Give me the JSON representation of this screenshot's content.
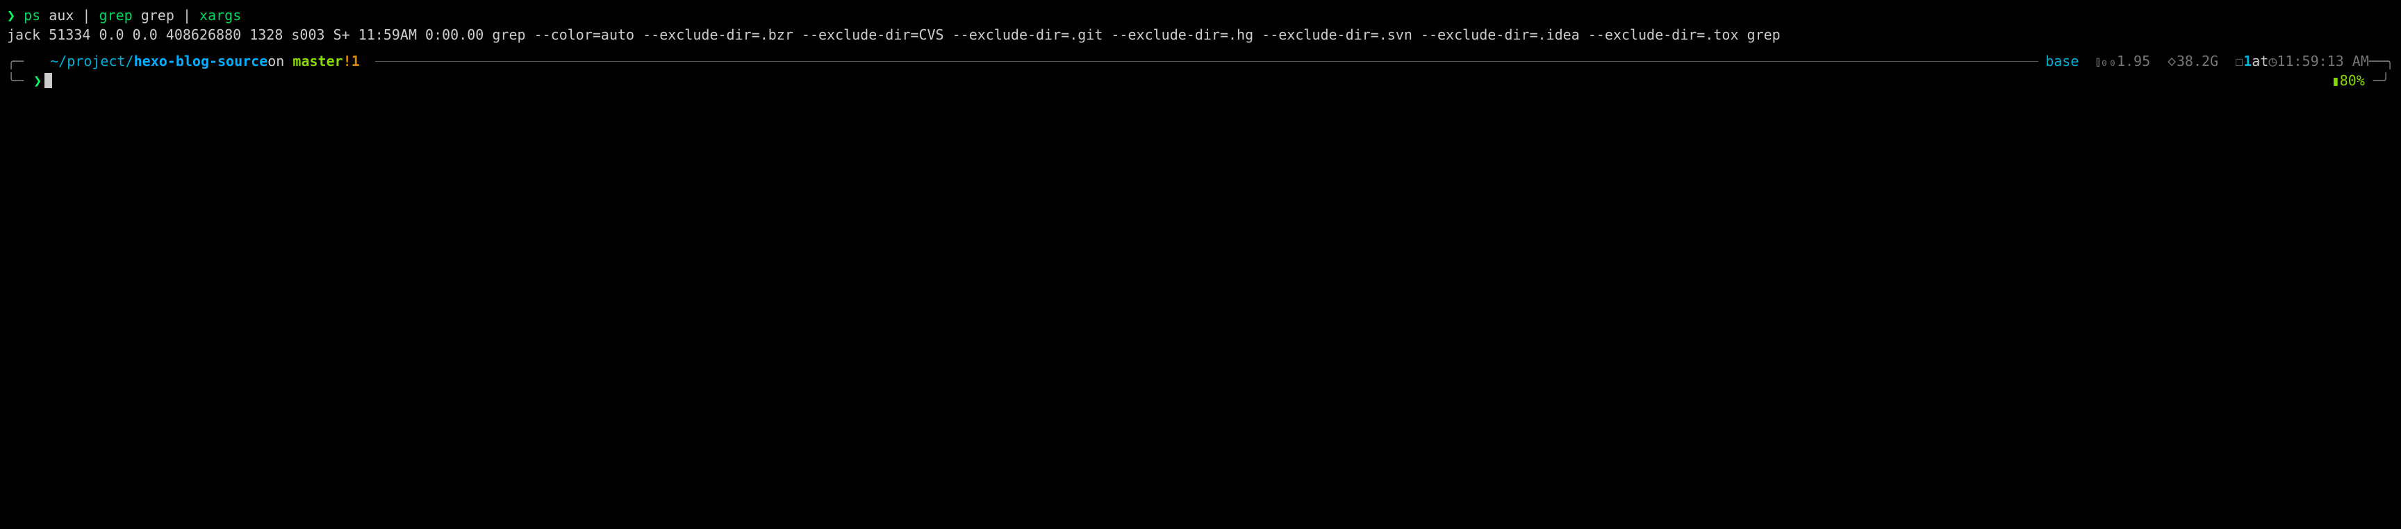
{
  "command": {
    "prompt": "❯",
    "part1": "ps",
    "part2": "aux",
    "pipe": "|",
    "part3": "grep",
    "part4": "grep",
    "part5": "xargs"
  },
  "output": "jack 51334 0.0 0.0 408626880 1328 s003 S+ 11:59AM 0:00.00 grep --color=auto --exclude-dir=.bzr --exclude-dir=CVS --exclude-dir=.git --exclude-dir=.hg --exclude-dir=.svn --exclude-dir=.idea --exclude-dir=.tox grep",
  "status": {
    "bracket_open": "╭─",
    "bracket_close": "─╮",
    "bracket_open2": "╰─",
    "bracket_close2": "─╯",
    "apple": "",
    "folder": "",
    "path_prefix": "~/project/",
    "path_name": "hexo-blog-source",
    "on": " on ",
    "git_icon": "",
    "branch_icon": "",
    "branch": " master",
    "dirty": " !1",
    "python_icon": "",
    "env": " base",
    "chart_icon": "⫾₀₀",
    "cpu": " 1.95",
    "mem_icon": "🝔",
    "mem": " 38.2G",
    "box_icon": "☐",
    "jobs": " 1",
    "at": " at ",
    "clock_icon": "◷",
    "time": " 11:59:13 AM",
    "dash": " ─",
    "prompt": "❯",
    "battery_icon": "▮",
    "battery": " 80%"
  }
}
